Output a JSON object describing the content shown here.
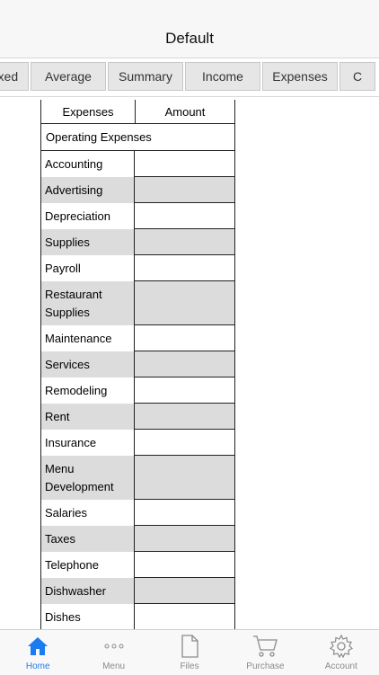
{
  "nav": {
    "title": "Default"
  },
  "segments": [
    {
      "label": "Fixed",
      "w": 58
    },
    {
      "label": "Average",
      "w": 84
    },
    {
      "label": "Summary",
      "w": 84
    },
    {
      "label": "Income",
      "w": 84
    },
    {
      "label": "Expenses",
      "w": 84
    },
    {
      "label": "C",
      "w": 40
    }
  ],
  "table": {
    "header": {
      "col1": "Expenses",
      "col2": "Amount"
    },
    "section": "Operating Expenses",
    "rows": [
      {
        "label": "Accounting",
        "value": ""
      },
      {
        "label": "Advertising",
        "value": ""
      },
      {
        "label": "Depreciation",
        "value": ""
      },
      {
        "label": "Supplies",
        "value": ""
      },
      {
        "label": "Payroll",
        "value": ""
      },
      {
        "label": "Restaurant Supplies",
        "value": ""
      },
      {
        "label": "Maintenance",
        "value": ""
      },
      {
        "label": "Services",
        "value": ""
      },
      {
        "label": "Remodeling",
        "value": ""
      },
      {
        "label": "Rent",
        "value": ""
      },
      {
        "label": "Insurance",
        "value": ""
      },
      {
        "label": "Menu Development",
        "value": ""
      },
      {
        "label": "Salaries",
        "value": ""
      },
      {
        "label": "Taxes",
        "value": ""
      },
      {
        "label": "Telephone",
        "value": ""
      },
      {
        "label": "Dishwasher",
        "value": ""
      },
      {
        "label": "Dishes",
        "value": ""
      }
    ]
  },
  "tabbar": {
    "home": "Home",
    "menu": "Menu",
    "files": "Files",
    "purchase": "Purchase",
    "account": "Account",
    "active_color": "#1a7cf0",
    "inactive_color": "#8a8a8a"
  }
}
